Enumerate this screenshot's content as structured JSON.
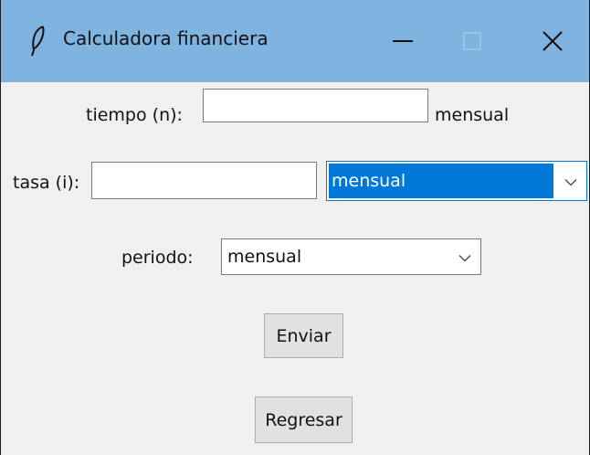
{
  "window": {
    "title": "Calculadora financiera",
    "icon": "feather-icon",
    "controls": [
      "minimize-icon",
      "maximize-icon",
      "close-icon"
    ]
  },
  "form": {
    "tiempo": {
      "label": "tiempo (n):",
      "value": "",
      "unit": "mensual"
    },
    "tasa": {
      "label": "tasa (i):",
      "value": "",
      "selected": "mensual"
    },
    "periodo": {
      "label": "periodo:",
      "selected": "mensual"
    },
    "buttons": {
      "enviar": "Enviar",
      "regresar": "Regresar"
    }
  },
  "colors": {
    "titlebar": "#7fb3e0",
    "selection": "#0078d7",
    "background": "#f0f0f0"
  }
}
